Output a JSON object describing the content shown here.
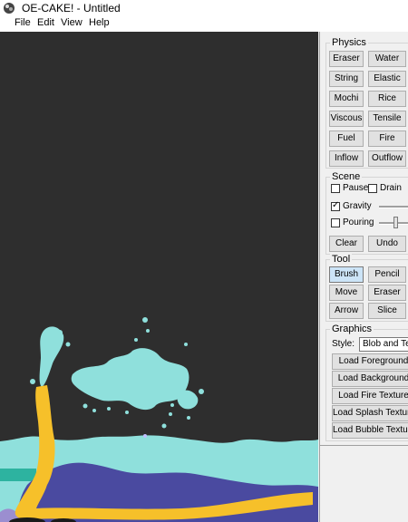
{
  "window": {
    "title": "OE-CAKE! - Untitled"
  },
  "menu": [
    "File",
    "Edit",
    "View",
    "Help"
  ],
  "physics": {
    "label": "Physics",
    "buttons": [
      "Eraser",
      "Water",
      "String",
      "Elastic",
      "Mochi",
      "Rice",
      "Viscous",
      "Tensile",
      "Fuel",
      "Fire",
      "Inflow",
      "Outflow"
    ]
  },
  "scene": {
    "label": "Scene",
    "pause_label": "Pause",
    "pause_checked": false,
    "drain_label": "Drain",
    "drain_checked": false,
    "gravity_label": "Gravity",
    "gravity_checked": true,
    "pouring_label": "Pouring",
    "pouring_checked": false,
    "clear_label": "Clear",
    "undo_label": "Undo"
  },
  "tool": {
    "label": "Tool",
    "buttons": [
      "Brush",
      "Pencil",
      "Move",
      "Eraser",
      "Arrow",
      "Slice"
    ],
    "active": "Brush"
  },
  "graphics": {
    "label": "Graphics",
    "style_label": "Style:",
    "style_value": "Blob and Text",
    "load_buttons": [
      "Load Foreground",
      "Load Background",
      "Load Fire Texture",
      "Load Splash Texture",
      "Load Bubble Texture"
    ]
  },
  "colors": {
    "canvas_bg": "#2e2e2e",
    "water": "#8fe0dc",
    "viscous": "#4a4aa0",
    "fuel": "#f6c02a"
  }
}
